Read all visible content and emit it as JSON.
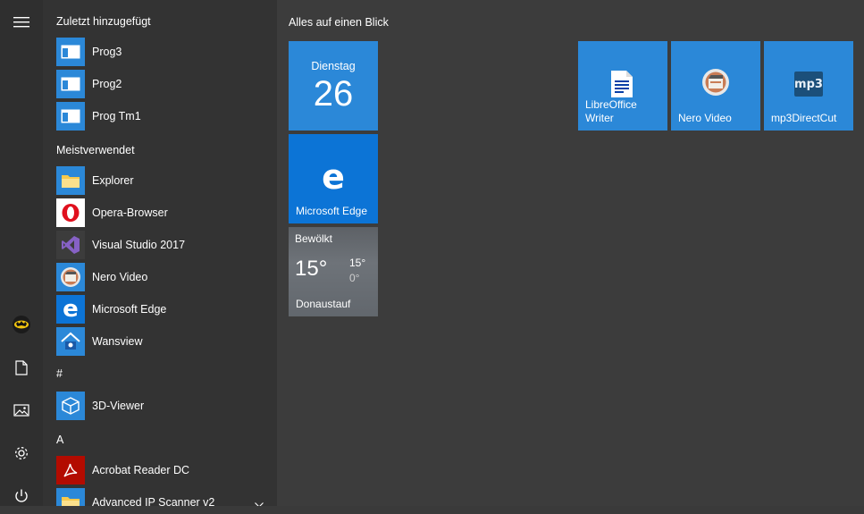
{
  "rail": {
    "items": [
      {
        "name": "hamburger-menu-icon"
      },
      {
        "name": "user-avatar"
      },
      {
        "name": "documents-icon"
      },
      {
        "name": "pictures-icon"
      },
      {
        "name": "settings-icon"
      },
      {
        "name": "power-icon"
      }
    ]
  },
  "applist": {
    "recent_header": "Zuletzt hinzugefügt",
    "recent": [
      {
        "label": "Prog3"
      },
      {
        "label": "Prog2"
      },
      {
        "label": "Prog Tm1"
      }
    ],
    "most_used_header": "Meistverwendet",
    "most_used": [
      {
        "label": "Explorer"
      },
      {
        "label": "Opera-Browser"
      },
      {
        "label": "Visual Studio 2017"
      },
      {
        "label": "Nero Video"
      },
      {
        "label": "Microsoft Edge"
      },
      {
        "label": "Wansview"
      }
    ],
    "hash_header": "#",
    "hash_items": [
      {
        "label": "3D-Viewer"
      }
    ],
    "a_header": "A",
    "a_items": [
      {
        "label": "Acrobat Reader DC"
      },
      {
        "label": "Advanced IP Scanner v2"
      }
    ]
  },
  "tiles": {
    "group_title": "Alles auf einen Blick",
    "calendar": {
      "day": "Dienstag",
      "date": "26"
    },
    "edge": {
      "label": "Microsoft Edge"
    },
    "weather": {
      "condition": "Bewölkt",
      "temp": "15°",
      "high": "15°",
      "low": "0°",
      "location": "Donaustauf"
    },
    "libreoffice": {
      "label_line1": "LibreOffice",
      "label_line2": "Writer"
    },
    "nero": {
      "label": "Nero Video"
    },
    "mp3": {
      "label": "mp3DirectCut",
      "icon_text": "mp3"
    }
  },
  "colors": {
    "tile_blue": "#2b88d8",
    "edge_blue": "#0c74d6",
    "background": "#3a3a3a"
  }
}
